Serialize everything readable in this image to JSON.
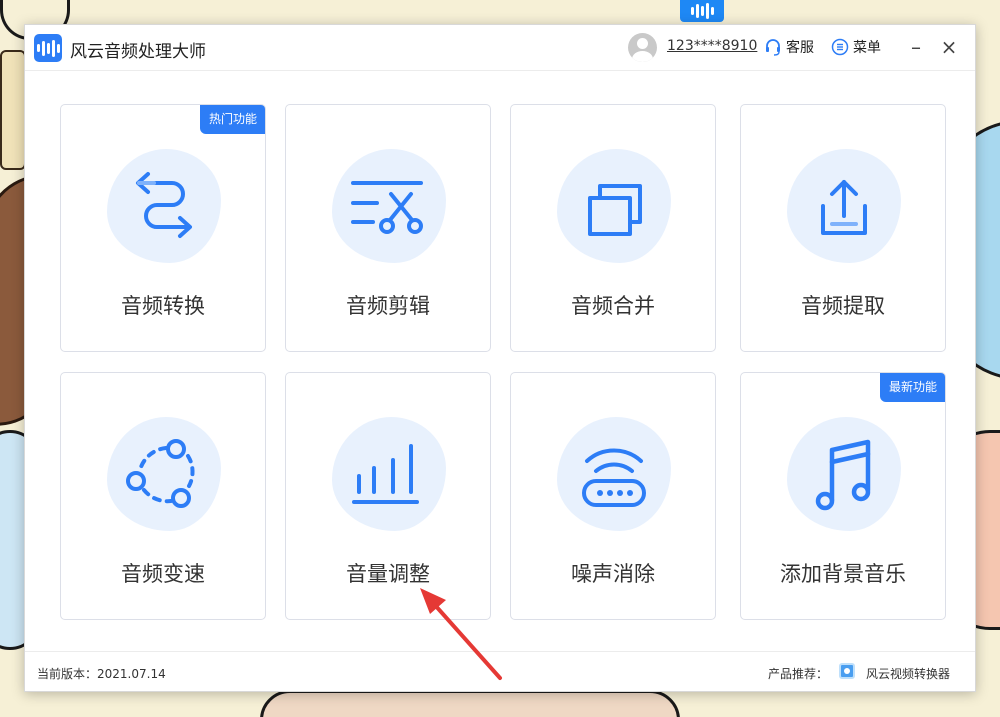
{
  "window": {
    "title": "风云音频处理大师",
    "user_id": "123****8910",
    "service_label": "客服",
    "menu_label": "菜单",
    "minimize_label": "–",
    "close_label": "×"
  },
  "features": [
    {
      "label": "音频转换",
      "icon": "convert-icon",
      "tag": "热门功能"
    },
    {
      "label": "音频剪辑",
      "icon": "scissors-icon",
      "tag": ""
    },
    {
      "label": "音频合并",
      "icon": "merge-icon",
      "tag": ""
    },
    {
      "label": "音频提取",
      "icon": "upload-icon",
      "tag": ""
    },
    {
      "label": "音频变速",
      "icon": "speed-nodes-icon",
      "tag": ""
    },
    {
      "label": "音量调整",
      "icon": "volume-bars-icon",
      "tag": ""
    },
    {
      "label": "噪声消除",
      "icon": "router-icon",
      "tag": ""
    },
    {
      "label": "添加背景音乐",
      "icon": "music-note-icon",
      "tag": "最新功能"
    }
  ],
  "footer": {
    "version": "当前版本：2021.07.14",
    "recommend_label": "产品推荐：",
    "recommend_product": "风云视频转换器"
  },
  "colors": {
    "accent": "#2d7df6",
    "icon_blob": "#e8f1fd",
    "annotation_arrow": "#e53935"
  }
}
